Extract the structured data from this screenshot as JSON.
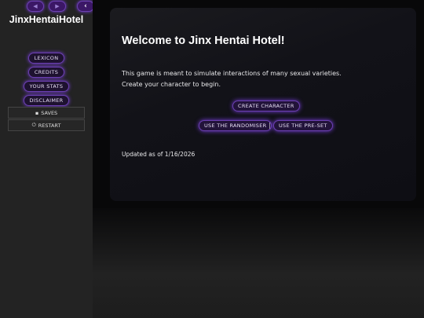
{
  "sidebar": {
    "title": "JinxHentaiHotel",
    "nav": {
      "back_icon": "arrow-left-icon",
      "forward_icon": "arrow-right-icon",
      "collapse_icon": "chevron-left-icon",
      "collapse_glyph": "‹"
    },
    "menu": [
      {
        "label": "LEXICON"
      },
      {
        "label": "CREDITS"
      },
      {
        "label": "YOUR STATS"
      },
      {
        "label": "DISCLAIMER"
      }
    ],
    "saves_label": "SAVES",
    "restart_label": "RESTART"
  },
  "passage": {
    "heading": "Welcome to Jinx Hentai Hotel!",
    "line1": "This game is meant to simulate interactions of many sexual varieties.",
    "line2": "Create your character to begin.",
    "create_button": "CREATE CHARACTER",
    "randomiser_button": "USE THE RANDOMISER",
    "separator": "|",
    "preset_button": "USE THE PRE-SET",
    "updated": "Updated as of 1/16/2026"
  },
  "colors": {
    "accent": "#6b3fb0",
    "glow": "#7a3fe0",
    "sidebar": "#232323"
  }
}
